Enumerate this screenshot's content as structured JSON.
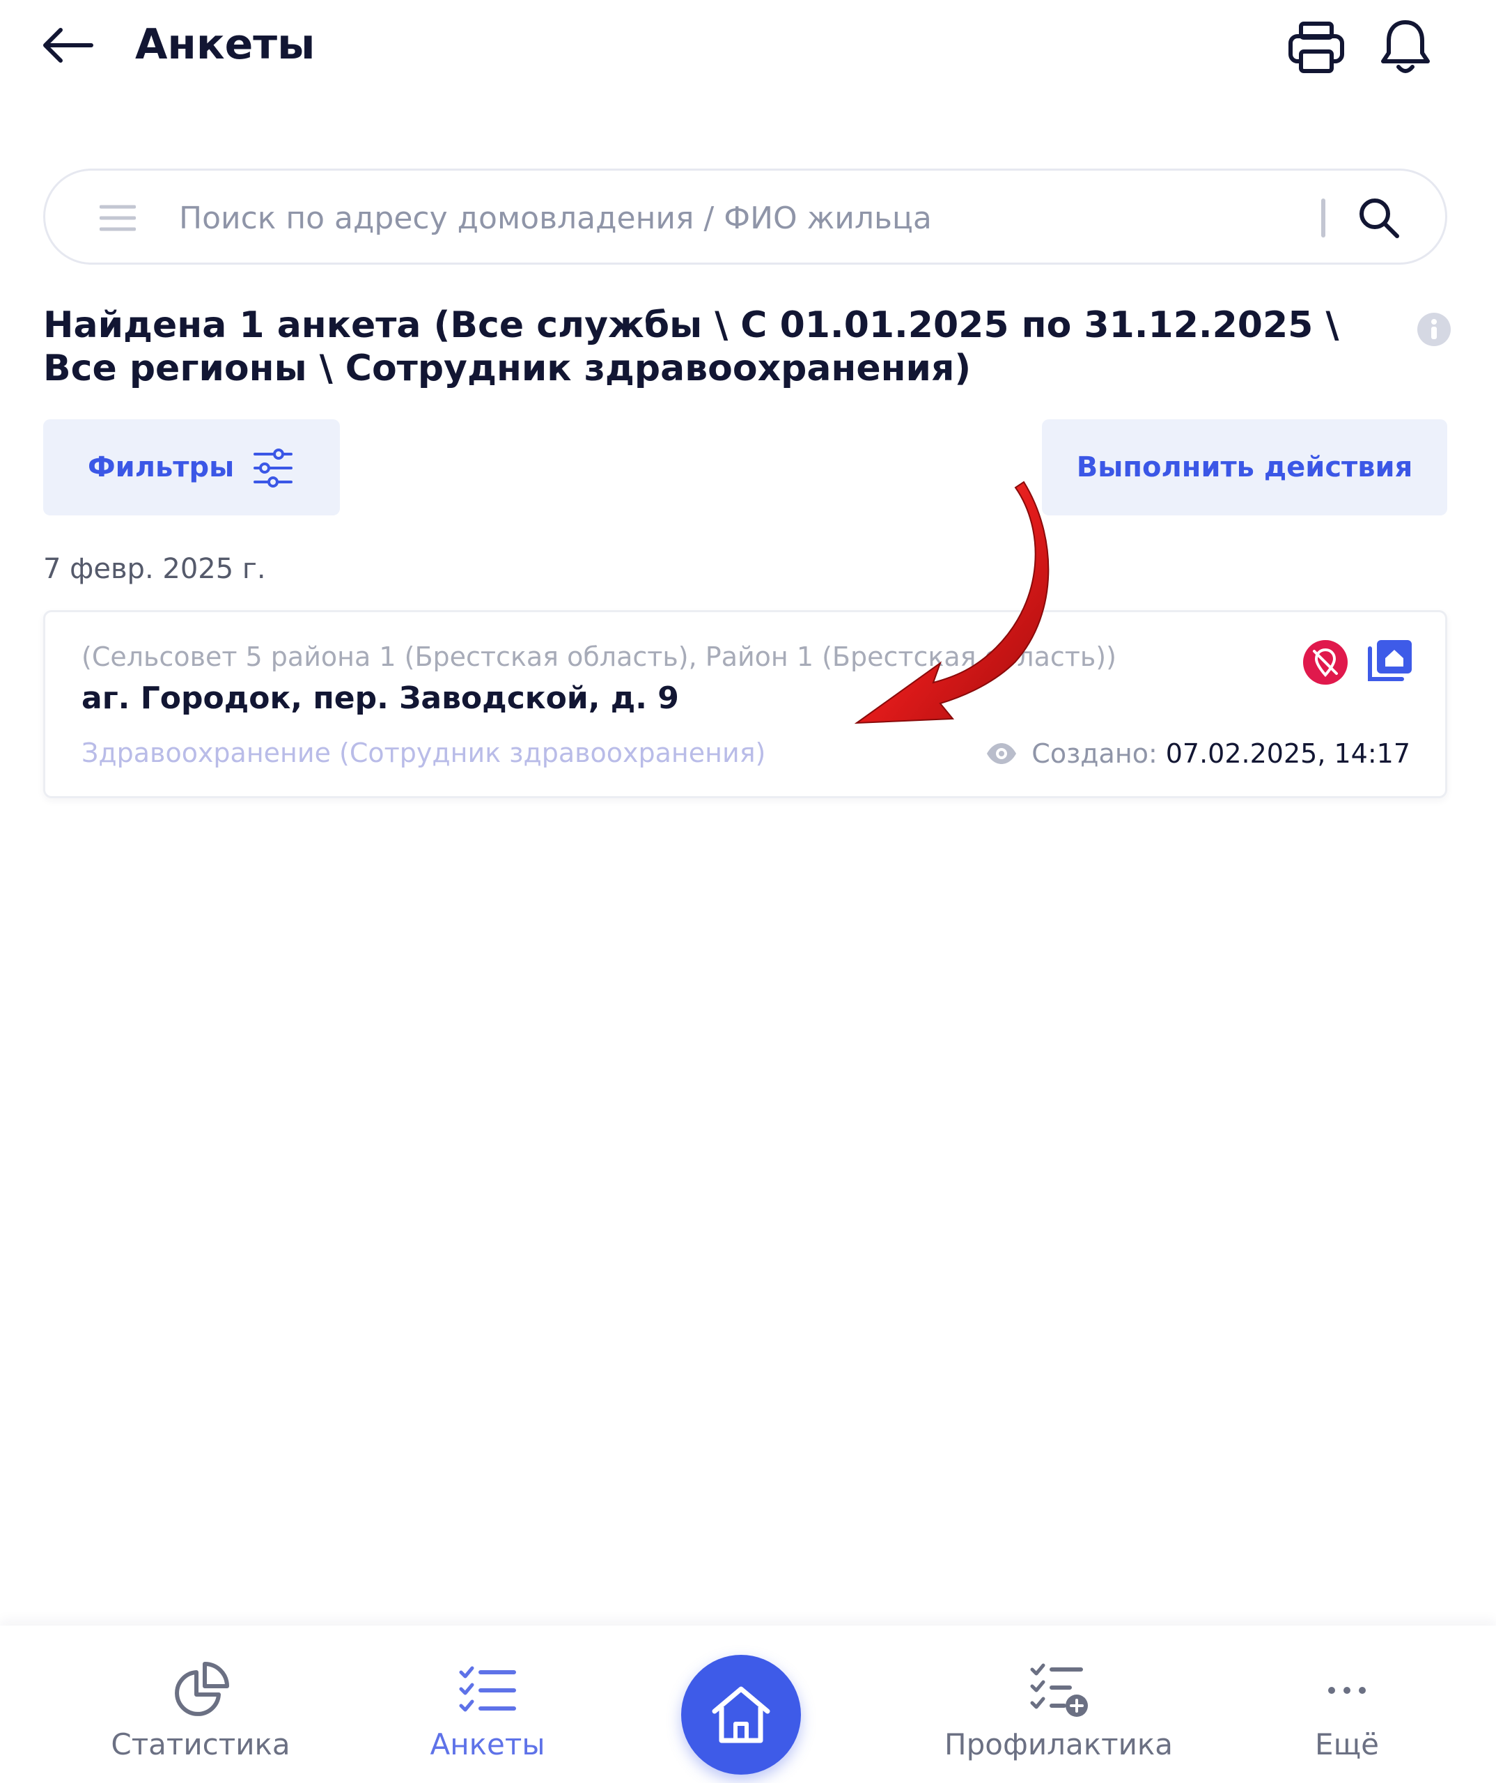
{
  "header": {
    "title": "Анкеты",
    "back_icon": "arrow-left-icon",
    "print_icon": "printer-icon",
    "notifications_icon": "bell-icon"
  },
  "search": {
    "placeholder": "Поиск по адресу домовладения / ФИО жильца",
    "value": ""
  },
  "summary": {
    "text": "Найдена 1 анкета (Все службы \\ С 01.01.2025 по 31.12.2025 \\ Все регионы \\ Сотрудник здравоохранения)"
  },
  "toolbar": {
    "filters_label": "Фильтры",
    "actions_label": "Выполнить действия"
  },
  "groups": [
    {
      "date": "7 февр. 2025 г.",
      "items": [
        {
          "region": "(Сельсовет 5 района 1 (Брестская область), Район 1 (Брестская область))",
          "address": "аг. Городок, пер. Заводской, д. 9",
          "service": "Здравоохранение (Сотрудник здравоохранения)",
          "created_label": "Создано:",
          "created_value": "07.02.2025, 14:17"
        }
      ]
    }
  ],
  "nav": {
    "items": [
      {
        "label": "Статистика",
        "icon": "pie-chart-icon"
      },
      {
        "label": "Анкеты",
        "icon": "checklist-icon"
      },
      {
        "label": "",
        "icon": "home-icon"
      },
      {
        "label": "Профилактика",
        "icon": "checklist-add-icon"
      },
      {
        "label": "Ещё",
        "icon": "more-icon"
      }
    ]
  },
  "colors": {
    "accent": "#3e5be8",
    "title": "#121633",
    "button_bg": "#edf1fb",
    "badge_red": "#e0194c",
    "annotation_red": "#e31b1b"
  }
}
